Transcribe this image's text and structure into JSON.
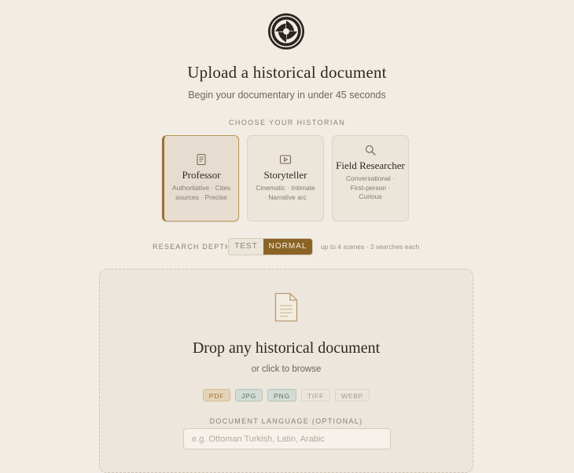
{
  "header": {
    "title": "Upload a historical document",
    "subtitle": "Begin your documentary in under 45 seconds"
  },
  "historian": {
    "section_label": "CHOOSE YOUR HISTORIAN",
    "selected": "professor",
    "cards": [
      {
        "id": "professor",
        "icon": "document-icon",
        "name": "Professor",
        "desc": "Authoritative · Cites sources · Precise"
      },
      {
        "id": "storyteller",
        "icon": "play-icon",
        "name": "Storyteller",
        "desc": "Cinematic · Intimate · Narrative arc"
      },
      {
        "id": "field-researcher",
        "icon": "search-icon",
        "name": "Field Researcher",
        "desc": "Conversational · First-person · Curious"
      }
    ]
  },
  "depth": {
    "label": "RESEARCH DEPTH",
    "options": [
      "TEST",
      "NORMAL"
    ],
    "selected": "NORMAL",
    "note": "up to 4 scenes · 3 searches each"
  },
  "dropzone": {
    "icon": "file-icon",
    "title": "Drop any historical document",
    "subtitle": "or click to browse",
    "formats": [
      "PDF",
      "JPG",
      "PNG",
      "TIFF",
      "WEBP"
    ]
  },
  "language": {
    "label": "DOCUMENT LANGUAGE (OPTIONAL)",
    "placeholder": "e.g. Ottoman Turkish, Latin, Arabic",
    "value": ""
  },
  "colors": {
    "background": "#f2ede4",
    "accent": "#8a6425",
    "text": "#2e2823"
  }
}
